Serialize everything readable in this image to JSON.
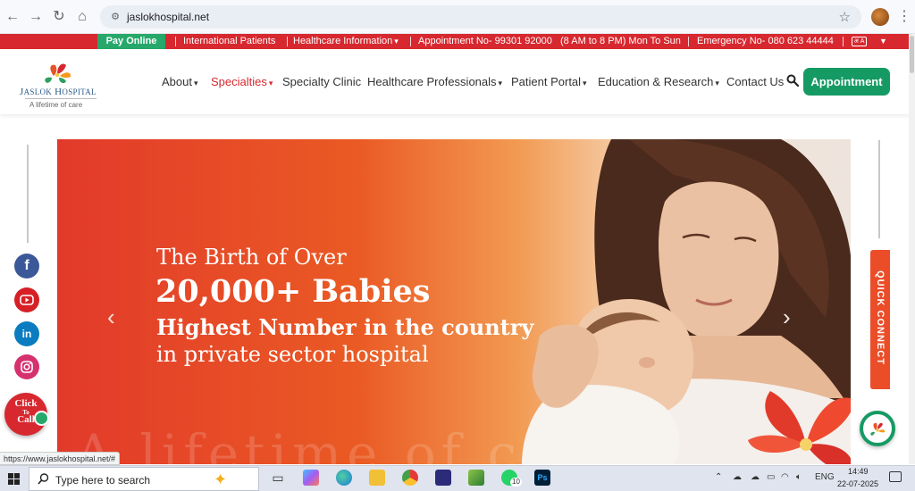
{
  "browser": {
    "url": "jaslokhospital.net",
    "status_url": "https://www.jaslokhospital.net/#"
  },
  "topbar": {
    "pay_online": "Pay Online",
    "international": "International Patients",
    "healthcare_info": "Healthcare Information",
    "appointment_no": "Appointment No- 99301 92000",
    "hours": "(8 AM to 8 PM) Mon To Sun",
    "emergency": "Emergency No- 080 623 44444",
    "lang": "अ A"
  },
  "logo": {
    "name": "Jaslok Hospital",
    "tagline": "A lifetime of care"
  },
  "nav": {
    "about": "About",
    "specialties": "Specialties",
    "specialty_clinic": "Specialty Clinic",
    "healthcare_professionals": "Healthcare Professionals",
    "patient_portal": "Patient Portal",
    "education": "Education & Research",
    "contact": "Contact Us",
    "appointment": "Appointment"
  },
  "hero": {
    "line1": "The Birth of Over",
    "line2": "20,000+ Babies",
    "line3": "Highest Number in the country",
    "line4": "in private sector hospital",
    "watermark": "A lifetime of c"
  },
  "sidebar": {
    "click_to_call": [
      "Click",
      "To",
      "Call"
    ],
    "quick_connect": "QUICK CONNECT"
  },
  "colors": {
    "brand_red": "#d7282f",
    "brand_green": "#169a64",
    "hero_orange": "#ea5a24"
  },
  "taskbar": {
    "search_placeholder": "Type here to search",
    "lang": "ENG",
    "time": "14:49",
    "date": "22-07-2025",
    "whatsapp_badge": "10"
  }
}
